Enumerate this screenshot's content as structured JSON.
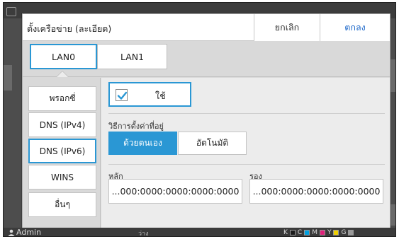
{
  "dialog": {
    "title": "ตั้งเครือข่าย (ละเอียด)",
    "cancel_label": "ยกเลิก",
    "ok_label": "ตกลง"
  },
  "tabs": [
    {
      "label": "LAN0",
      "selected": true
    },
    {
      "label": "LAN1",
      "selected": false
    }
  ],
  "nav": [
    {
      "label": "พรอกซี่",
      "selected": false
    },
    {
      "label": "DNS (IPv4)",
      "selected": false
    },
    {
      "label": "DNS (IPv6)",
      "selected": true
    },
    {
      "label": "WINS",
      "selected": false
    },
    {
      "label": "อื่นๆ",
      "selected": false
    }
  ],
  "content": {
    "use_label": "ใช้",
    "use_checked": true,
    "method_label": "วิธีการตั้งค่าที่อยู่",
    "method_manual": "ด้วยตนเอง",
    "method_auto": "อัตโนมัติ",
    "method_selected": "manual",
    "primary_label": "หลัก",
    "primary_value": "...000:0000:0000:0000:0000",
    "secondary_label": "รอง",
    "secondary_value": "...000:0000:0000:0000:0000"
  },
  "status_bar": {
    "user": "Admin",
    "status": "ว่าง",
    "toner": [
      {
        "letter": "K",
        "color": "#1a1a1a"
      },
      {
        "letter": "C",
        "color": "#00a0e0"
      },
      {
        "letter": "M",
        "color": "#e0207a"
      },
      {
        "letter": "Y",
        "color": "#f0d000"
      },
      {
        "letter": "G",
        "color": "#9a9a9a"
      }
    ]
  },
  "colors": {
    "accent": "#2a97d4",
    "ok_text": "#1a66c9"
  }
}
